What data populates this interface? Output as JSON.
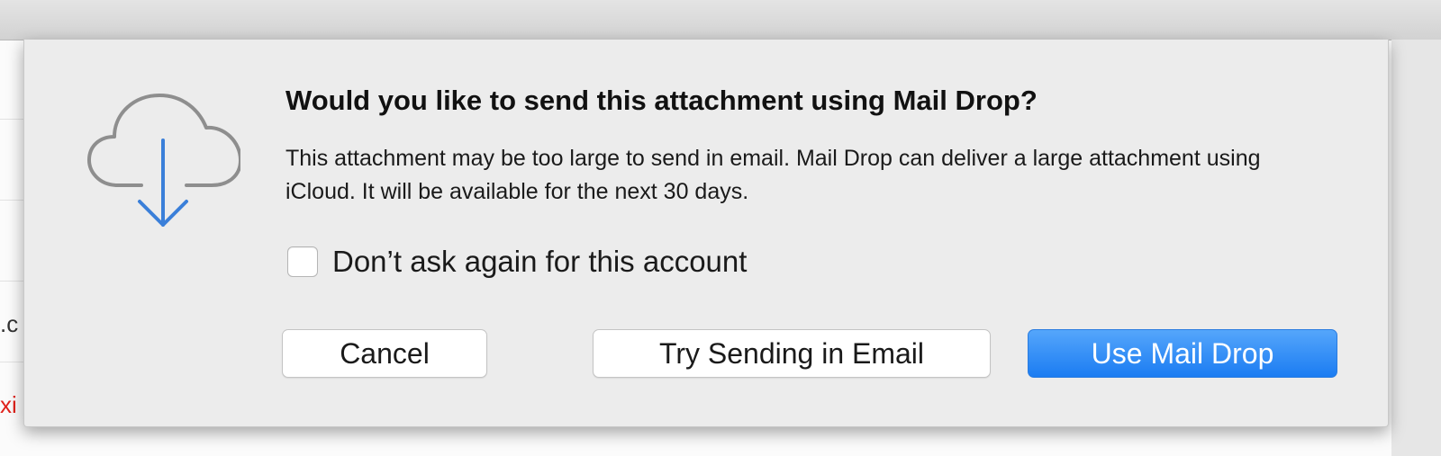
{
  "background": {
    "partial_texts": [
      ".c",
      "xi"
    ]
  },
  "dialog": {
    "icon": "icloud-download-icon",
    "title": "Would you like to send this attachment using Mail Drop?",
    "message": "This attachment may be too large to send in email. Mail Drop can deliver a large attachment using iCloud. It will be available for the next 30 days.",
    "checkbox": {
      "label": "Don’t ask again for this account",
      "checked": false
    },
    "buttons": {
      "cancel": "Cancel",
      "try_email": "Try Sending in Email",
      "use_mail_drop": "Use Mail Drop"
    }
  },
  "colors": {
    "accent": "#1b7cf2",
    "icon_arrow": "#3a7fd9",
    "icon_cloud": "#8e8e8e"
  }
}
